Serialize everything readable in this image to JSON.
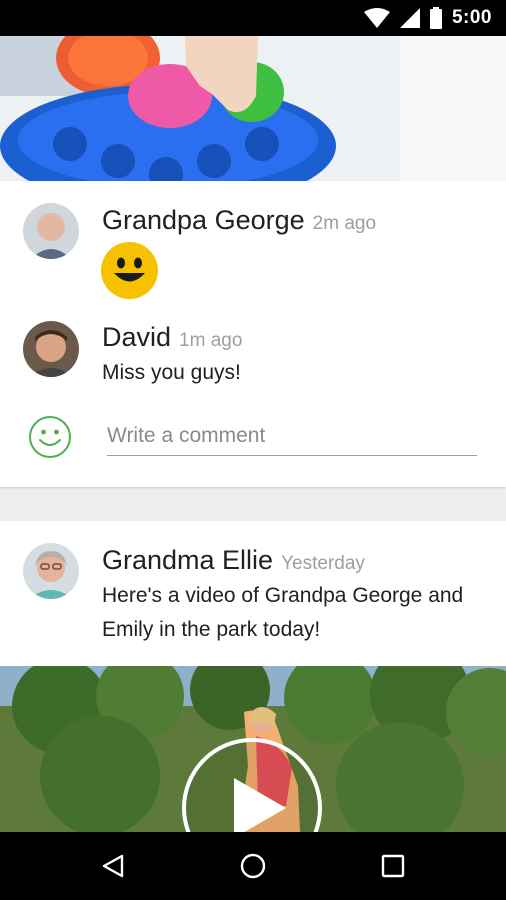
{
  "status_bar": {
    "time": "5:00"
  },
  "posts": [
    {
      "author": "Grandpa George",
      "time": "2m ago",
      "content_icon": "smiley-emoji"
    },
    {
      "author": "David",
      "time": "1m ago",
      "text": "Miss you guys!"
    },
    {
      "author": "Grandma Ellie",
      "time": "Yesterday",
      "text_line1": "Here's a video of Grandpa George and",
      "text_line2": "Emily in the park today!"
    }
  ],
  "comment": {
    "placeholder": "Write a comment",
    "emoji_icon": "smiley-outline-icon"
  },
  "colors": {
    "emoji_yellow": "#f6c200",
    "smiley_green": "#4caf50",
    "text_primary": "#212121",
    "text_secondary": "#9e9e9e"
  },
  "nav": {
    "back_icon": "back-triangle-icon",
    "home_icon": "home-circle-icon",
    "recents_icon": "recents-square-icon"
  }
}
